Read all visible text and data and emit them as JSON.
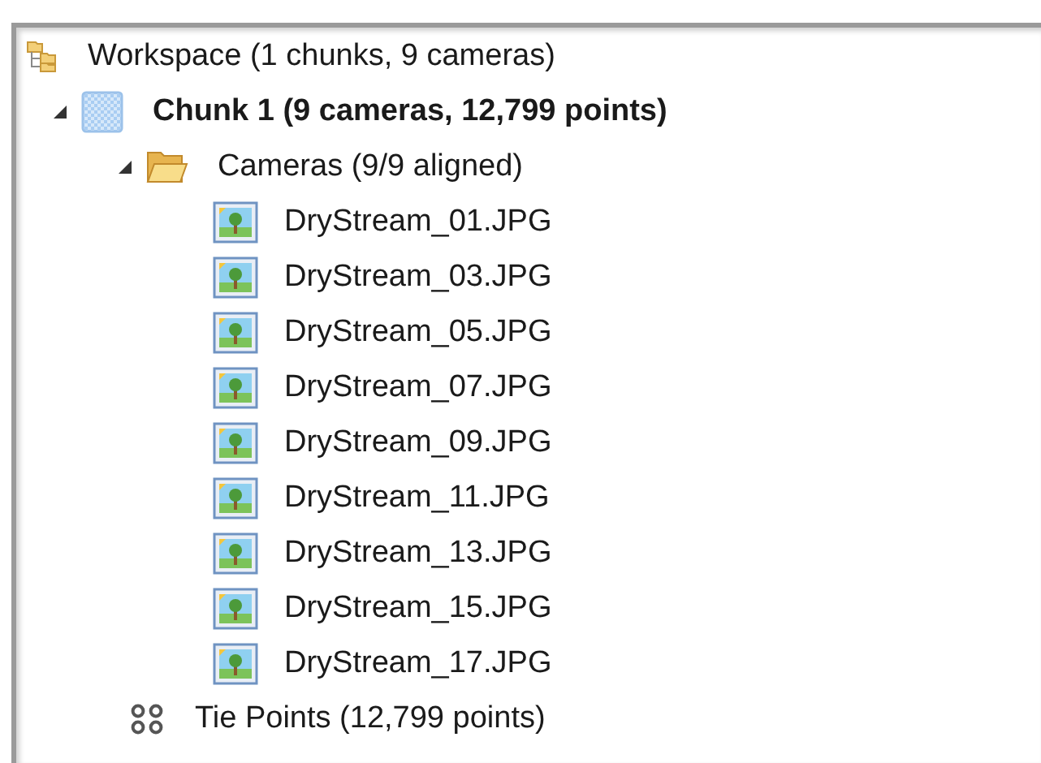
{
  "tree": {
    "label": "Workspace (1 chunks, 9 cameras)",
    "kind": "workspace",
    "children": [
      {
        "label": "Chunk 1 (9 cameras, 12,799 points)",
        "kind": "chunk",
        "expanded": true,
        "children": [
          {
            "label": "Cameras (9/9 aligned)",
            "kind": "folder",
            "expanded": true,
            "children": [
              {
                "label": "DryStream_01.JPG",
                "kind": "image"
              },
              {
                "label": "DryStream_03.JPG",
                "kind": "image"
              },
              {
                "label": "DryStream_05.JPG",
                "kind": "image"
              },
              {
                "label": "DryStream_07.JPG",
                "kind": "image"
              },
              {
                "label": "DryStream_09.JPG",
                "kind": "image"
              },
              {
                "label": "DryStream_11.JPG",
                "kind": "image"
              },
              {
                "label": "DryStream_13.JPG",
                "kind": "image"
              },
              {
                "label": "DryStream_15.JPG",
                "kind": "image"
              },
              {
                "label": "DryStream_17.JPG",
                "kind": "image"
              }
            ]
          },
          {
            "label": "Tie Points (12,799 points)",
            "kind": "points"
          }
        ]
      }
    ]
  }
}
